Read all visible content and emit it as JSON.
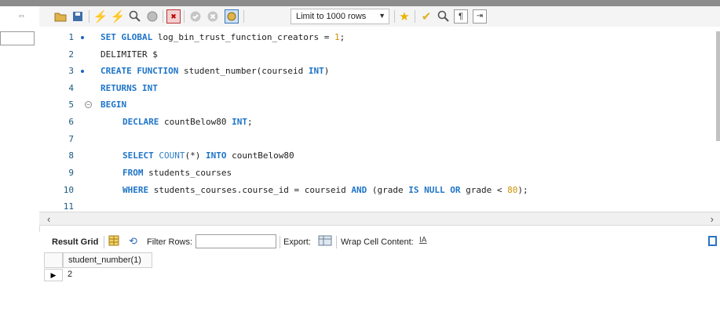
{
  "toolbar": {
    "limit_label": "Limit to 1000 rows",
    "icons": [
      "open-folder-icon",
      "save-icon",
      "execute-icon",
      "execute-current-icon",
      "explain-icon",
      "stop-icon",
      "toggle-error-icon",
      "commit-icon",
      "rollback-icon",
      "autocommit-icon",
      "beautify-icon",
      "find-icon",
      "invisible-chars-icon",
      "wrap-icon"
    ]
  },
  "editor": {
    "lines": [
      {
        "n": "1",
        "dot": true
      },
      {
        "n": "2"
      },
      {
        "n": "3",
        "dot": true
      },
      {
        "n": "4"
      },
      {
        "n": "5",
        "fold": true
      },
      {
        "n": "6"
      },
      {
        "n": "7"
      },
      {
        "n": "8"
      },
      {
        "n": "9"
      },
      {
        "n": "10"
      },
      {
        "n": "11"
      }
    ],
    "code": {
      "l1": {
        "kw1": "SET GLOBAL",
        "mid": " log_bin_trust_function_creators = ",
        "num": "1",
        "end": ";"
      },
      "l2": {
        "text": "DELIMITER $"
      },
      "l3": {
        "kw1": "CREATE FUNCTION",
        "mid": " student_number(courseid ",
        "kw2": "INT",
        "end": ")"
      },
      "l4": {
        "kw1": "RETURNS INT"
      },
      "l5": {
        "kw1": "BEGIN"
      },
      "l6": {
        "kw1": "DECLARE",
        "mid": " countBelow80 ",
        "kw2": "INT",
        "end": ";"
      },
      "l8": {
        "kw1": "SELECT",
        "fn": " COUNT",
        "mid": "(*) ",
        "kw2": "INTO",
        "end": " countBelow80"
      },
      "l9": {
        "kw1": "FROM",
        "end": " students_courses"
      },
      "l10": {
        "kw1": "WHERE",
        "a": " students_courses.course_id = courseid ",
        "kw2": "AND",
        "b": " (grade ",
        "kw3": "IS NULL OR",
        "c": " grade < ",
        "num": "80",
        "end": ");"
      }
    }
  },
  "results": {
    "tab_label": "Result Grid",
    "filter_label": "Filter Rows:",
    "export_label": "Export:",
    "wrap_label": "Wrap Cell Content:",
    "column_header": "student_number(1)",
    "rows": [
      "2"
    ]
  }
}
